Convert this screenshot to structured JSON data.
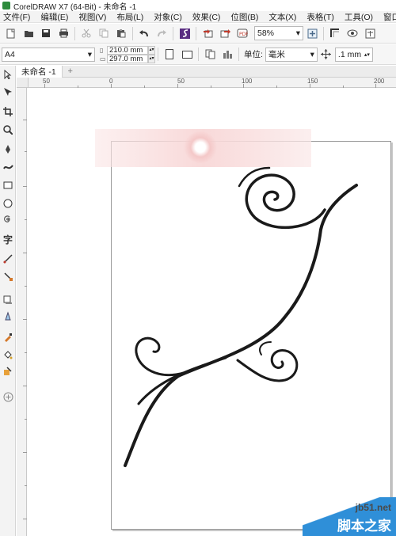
{
  "titlebar": {
    "title": "CorelDRAW X7 (64-Bit) - 未命名 -1"
  },
  "menu": [
    "文件(F)",
    "编辑(E)",
    "视图(V)",
    "布局(L)",
    "对象(C)",
    "效果(C)",
    "位图(B)",
    "文本(X)",
    "表格(T)",
    "工具(O)",
    "窗口("
  ],
  "toolbar1": {
    "zoom": "58%"
  },
  "toolbar2": {
    "paper": "A4",
    "width": "210.0 mm",
    "height": "297.0 mm",
    "units_label": "单位:",
    "units_value": "毫米",
    "nudge": ".1 mm"
  },
  "tabs": {
    "doc_tab": "未命名 -1",
    "add": "+"
  },
  "ruler": {
    "labels": [
      "50",
      "0",
      "50",
      "100",
      "150",
      "200"
    ]
  },
  "watermark": {
    "site": "jb51.net",
    "name": "脚本之家"
  },
  "colors": {
    "accent": "#2e8b3d",
    "watermark_blue": "#2f8fd8",
    "stroke": "#1a1a1a"
  },
  "icons": [
    "new-icon",
    "open-icon",
    "save-icon",
    "print-icon",
    "cut-icon",
    "copy-icon",
    "paste-icon",
    "undo-icon",
    "redo-icon",
    "corel-connect-icon",
    "import-icon",
    "export-icon",
    "publish-pdf-icon",
    "zoom-icon",
    "view-full-icon",
    "view-mode-icon",
    "pick-tool-icon",
    "shape-tool-icon",
    "crop-tool-icon",
    "zoom-tool-icon",
    "freehand-tool-icon",
    "artistic-media-icon",
    "rectangle-tool-icon",
    "ellipse-tool-icon",
    "spiral-tool-icon",
    "text-tool-icon",
    "dimension-tool-icon",
    "connector-tool-icon",
    "shadow-tool-icon",
    "transparency-tool-icon",
    "eyedropper-tool-icon",
    "fill-tool-icon",
    "smart-fill-icon",
    "add-tool-icon"
  ]
}
